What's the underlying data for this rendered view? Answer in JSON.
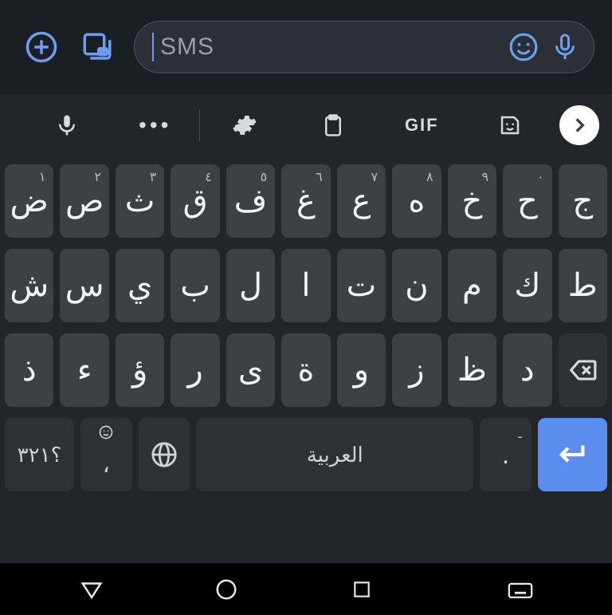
{
  "compose": {
    "placeholder": "SMS"
  },
  "suggestion_bar": {
    "gif_label": "GIF"
  },
  "keyboard": {
    "row1": [
      {
        "main": "ض",
        "hint": "١"
      },
      {
        "main": "ص",
        "hint": "٢"
      },
      {
        "main": "ث",
        "hint": "٣"
      },
      {
        "main": "ق",
        "hint": "٤"
      },
      {
        "main": "ف",
        "hint": "٥"
      },
      {
        "main": "غ",
        "hint": "٦"
      },
      {
        "main": "ع",
        "hint": "٧"
      },
      {
        "main": "ه",
        "hint": "٨"
      },
      {
        "main": "خ",
        "hint": "٩"
      },
      {
        "main": "ح",
        "hint": "٠"
      },
      {
        "main": "ج",
        "hint": ""
      }
    ],
    "row2": [
      {
        "main": "ش"
      },
      {
        "main": "س"
      },
      {
        "main": "ي"
      },
      {
        "main": "ب"
      },
      {
        "main": "ل"
      },
      {
        "main": "ا"
      },
      {
        "main": "ت"
      },
      {
        "main": "ن"
      },
      {
        "main": "م"
      },
      {
        "main": "ك"
      },
      {
        "main": "ط"
      }
    ],
    "row3": [
      {
        "main": "ذ"
      },
      {
        "main": "ء"
      },
      {
        "main": "ؤ"
      },
      {
        "main": "ر"
      },
      {
        "main": "ى"
      },
      {
        "main": "ة"
      },
      {
        "main": "و"
      },
      {
        "main": "ز"
      },
      {
        "main": "ظ"
      },
      {
        "main": "د"
      }
    ],
    "row4": {
      "symbols": "؟٣٢١",
      "emoji_hint": "،",
      "space": "العربية",
      "period": ".",
      "period_hint": "ـ"
    }
  }
}
